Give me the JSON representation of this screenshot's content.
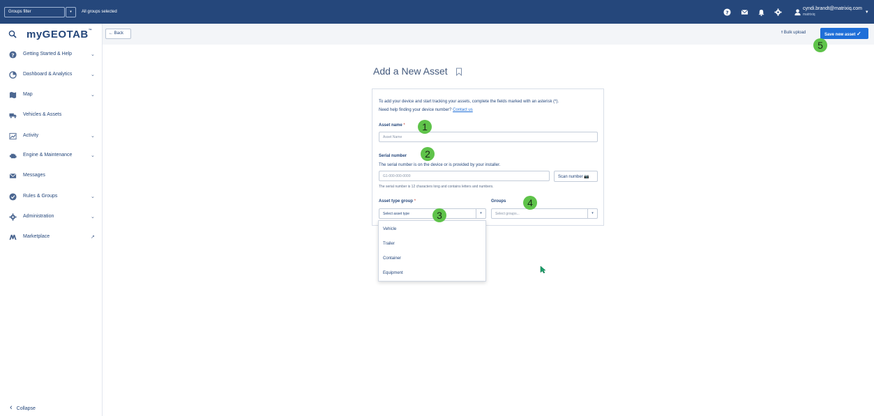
{
  "topbar": {
    "groups_filter_label": "Groups filter",
    "groups_filter_caret": "▾",
    "groups_selected_text": "All groups selected",
    "icons": [
      "help-icon",
      "mail-icon",
      "bell-icon",
      "gear-icon",
      "user-icon"
    ],
    "user_email": "cyndi.brandt@matrixiq.com",
    "user_org": "matrixiq",
    "user_caret": "▾"
  },
  "sidebar": {
    "logo": "myGEOTAB",
    "logo_tm": "™",
    "items": [
      {
        "label": "Getting Started & Help",
        "icon": "help-circle-icon",
        "chevron": "⌄"
      },
      {
        "label": "Dashboard & Analytics",
        "icon": "chart-pie-icon",
        "chevron": "⌄"
      },
      {
        "label": "Map",
        "icon": "map-icon",
        "chevron": "⌄"
      },
      {
        "label": "Vehicles & Assets",
        "icon": "truck-icon",
        "chevron": ""
      },
      {
        "label": "Activity",
        "icon": "activity-chart-icon",
        "chevron": "⌄"
      },
      {
        "label": "Engine & Maintenance",
        "icon": "engine-icon",
        "chevron": "⌄"
      },
      {
        "label": "Messages",
        "icon": "mail-icon",
        "chevron": ""
      },
      {
        "label": "Rules & Groups",
        "icon": "rules-icon",
        "chevron": "⌄"
      },
      {
        "label": "Administration",
        "icon": "gear-icon",
        "chevron": "⌄"
      },
      {
        "label": "Marketplace",
        "icon": "marketplace-icon",
        "chevron": "↗"
      }
    ],
    "collapse_label": "Collapse",
    "collapse_chevron": "‹"
  },
  "toolbar": {
    "back_label": "Back",
    "bulk_upload_label": "Bulk upload",
    "save_label": "Save new asset"
  },
  "form": {
    "title": "Add a New Asset",
    "intro_line1": "To add your device and start tracking your assets, complete the fields marked with an asterisk (*).",
    "intro_line2": "Need help finding your device number?",
    "contact_link": "Contact us",
    "asset_name_label": "Asset name",
    "asset_name_placeholder": "Asset Name",
    "serial_label": "Serial number",
    "serial_help": "The serial number is on the device or is provided by your installer.",
    "serial_placeholder": "G1-000-000-0000",
    "scan_label": "Scan number",
    "serial_note": "The serial number is 12 characters long and contains letters and numbers.",
    "asset_type_label": "Asset type group",
    "asset_type_placeholder": "Select asset type",
    "groups_label": "Groups",
    "groups_placeholder": "Select groups...",
    "required_mark": "*",
    "caret": "▾",
    "asset_type_options": [
      "Vehicle",
      "Trailer",
      "Container",
      "Equipment"
    ]
  },
  "callouts": [
    "1",
    "2",
    "3",
    "4",
    "5"
  ],
  "colors": {
    "topbar": "#25477b",
    "primary": "#1f6fd8",
    "callout": "#5fc34a",
    "cursor": "#1aa06a"
  }
}
